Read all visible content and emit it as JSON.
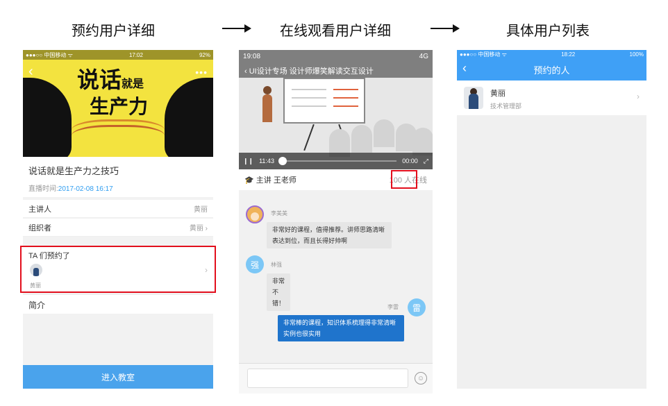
{
  "captions": {
    "step1": "预约用户详细",
    "step2": "在线观看用户详细",
    "step3": "具体用户列表"
  },
  "phone1": {
    "status_left": "●●●○○ 中国移动 ᯤ",
    "status_time": "17:02",
    "status_right": "92%",
    "hero_line1": "说话",
    "hero_line1_small": "就是",
    "hero_line2": "生产力",
    "course_title": "说话就是生产力之技巧",
    "live_time_label": "直播时间:",
    "live_time_value": "2017-02-08 16:17",
    "rows": [
      {
        "label": "主讲人",
        "value": "黄丽",
        "chevron": ""
      },
      {
        "label": "组织者",
        "value": "黄丽",
        "chevron": "›"
      }
    ],
    "booked_label": "TA 们预约了",
    "booked_user": "黄丽",
    "intro_label": "简介",
    "enter_button": "进入教室"
  },
  "phone2": {
    "status_time": "19:08",
    "status_right": "4G",
    "video_title": "UI设计专场 设计师爆笑解读交互设计",
    "time_current": "11:43",
    "time_total": "00:00",
    "lecturer": "主讲 王老师",
    "online_count": "100 人在线",
    "messages": [
      {
        "name": "李美美",
        "avatar": "",
        "text": "非常好的课程，值得推荐。讲师思路清晰表达到位，而且长得好帅啊"
      },
      {
        "name": "林强",
        "avatar": "强",
        "text": "非常不错！"
      },
      {
        "name": "李雷",
        "avatar": "雷",
        "text": "非常棒的课程，知识体系梳理得非常清晰实例也很实用"
      }
    ]
  },
  "phone3": {
    "status_left": "●●●○○ 中国移动 ᯤ",
    "status_time": "18:22",
    "status_right": "100%",
    "title": "预约的人",
    "back": "‹",
    "users": [
      {
        "name": "黄丽",
        "dept": "技术管理部"
      }
    ]
  },
  "colors": {
    "accent_blue": "#3fa0f6",
    "highlight_red": "#e20e1c",
    "chat_blue": "#1f74cc"
  }
}
